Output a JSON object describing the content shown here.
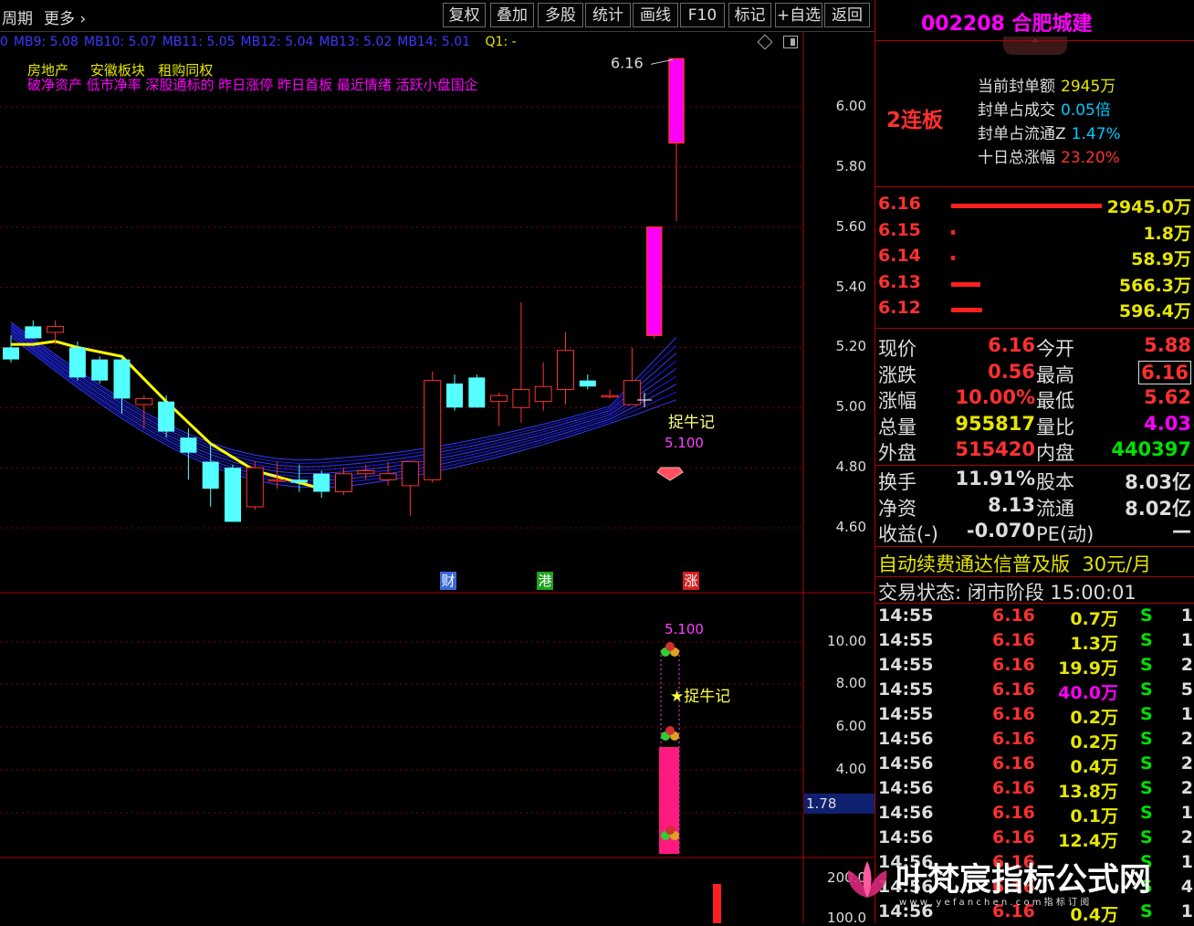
{
  "toolbar": {
    "period": "周期",
    "more": "更多",
    "buttons": [
      "复权",
      "叠加",
      "多股",
      "统计",
      "画线",
      "F10",
      "标记",
      "+自选",
      "返回"
    ]
  },
  "ma_row": {
    "items": [
      "0",
      "MB9: 5.08",
      "MB10: 5.07",
      "MB11: 5.05",
      "MB12: 5.04",
      "MB13: 5.02",
      "MB14: 5.01"
    ],
    "q1": "Q1: -"
  },
  "tags": {
    "line1": [
      "房地产",
      "安徽板块",
      "租购同权"
    ],
    "line2": "破净资产 低市净率 深股通标的 昨日涨停 昨日首板 最近情绪 活跃小盘国企"
  },
  "main_chart": {
    "high_label": "6.16",
    "annotation": "捉牛记",
    "annotation_value": "5.100",
    "y_ticks": [
      "6.00",
      "5.80",
      "5.60",
      "5.40",
      "5.20",
      "5.00",
      "4.80",
      "4.60"
    ],
    "markers": [
      {
        "text": "财",
        "color": "#3a6ad8"
      },
      {
        "text": "港",
        "color": "#20a020"
      },
      {
        "text": "涨",
        "color": "#d02020"
      }
    ]
  },
  "sub_chart": {
    "value_label": "5.100",
    "annotation": "★捉牛记",
    "y_ticks": [
      "10.00",
      "8.00",
      "6.00",
      "4.00"
    ],
    "current": "1.78"
  },
  "vol_chart": {
    "y_ticks": [
      "200.0",
      "100.0"
    ]
  },
  "panel": {
    "code_name": "002208 合肥城建",
    "limit_label": "2连板",
    "limit_info": [
      {
        "label": "当前封单额",
        "value": "2945万",
        "color": "#e6e600"
      },
      {
        "label": "封单占成交",
        "value": "0.05倍",
        "color": "#00c8ff"
      },
      {
        "label": "封单占流通Z",
        "value": "1.47%",
        "color": "#00c8ff"
      },
      {
        "label": "十日总涨幅",
        "value": "23.20%",
        "color": "#ff3030"
      }
    ],
    "order_book": [
      {
        "price": "6.16",
        "volume": "2945.0万",
        "bar": 0.98
      },
      {
        "price": "6.15",
        "volume": "1.8万",
        "bar": 0.02
      },
      {
        "price": "6.14",
        "volume": "58.9万",
        "bar": 0.02
      },
      {
        "price": "6.13",
        "volume": "566.3万",
        "bar": 0.19
      },
      {
        "price": "6.12",
        "volume": "596.4万",
        "bar": 0.2
      }
    ],
    "quotes_a": [
      {
        "l1": "现价",
        "v1": "6.16",
        "c1": "#ff3030",
        "l2": "今开",
        "v2": "5.88",
        "c2": "#ff3030"
      },
      {
        "l1": "涨跌",
        "v1": "0.56",
        "c1": "#ff3030",
        "l2": "最高",
        "v2": "6.16",
        "c2": "#ff3030"
      },
      {
        "l1": "涨幅",
        "v1": "10.00%",
        "c1": "#ff3030",
        "l2": "最低",
        "v2": "5.62",
        "c2": "#ff3030"
      },
      {
        "l1": "总量",
        "v1": "955817",
        "c1": "#e6e600",
        "l2": "量比",
        "v2": "4.03",
        "c2": "#ff00ff"
      },
      {
        "l1": "外盘",
        "v1": "515420",
        "c1": "#ff3030",
        "l2": "内盘",
        "v2": "440397",
        "c2": "#00e000"
      }
    ],
    "quotes_b": [
      {
        "l1": "换手",
        "v1": "11.91%",
        "c1": "#ddd",
        "l2": "股本",
        "v2": "8.03亿",
        "c2": "#ddd"
      },
      {
        "l1": "净资",
        "v1": "8.13",
        "c1": "#ddd",
        "l2": "流通",
        "v2": "8.02亿",
        "c2": "#ddd"
      },
      {
        "l1": "收益(-)",
        "v1": "-0.070",
        "c1": "#ddd",
        "l2": "PE(动)",
        "v2": "—",
        "c2": "#ddd"
      }
    ],
    "promo": "自动续费通达信普及版  30元/月",
    "trade_status": "交易状态: 闭市阶段 15:00:01",
    "ticks": [
      {
        "time": "14:55",
        "price": "6.16",
        "vol": "0.7万",
        "side": "S",
        "n": "1",
        "vc": "#e6e600"
      },
      {
        "time": "14:55",
        "price": "6.16",
        "vol": "1.3万",
        "side": "S",
        "n": "1",
        "vc": "#e6e600"
      },
      {
        "time": "14:55",
        "price": "6.16",
        "vol": "19.9万",
        "side": "S",
        "n": "2",
        "vc": "#e6e600"
      },
      {
        "time": "14:55",
        "price": "6.16",
        "vol": "40.0万",
        "side": "S",
        "n": "5",
        "vc": "#ff00ff"
      },
      {
        "time": "14:55",
        "price": "6.16",
        "vol": "0.2万",
        "side": "S",
        "n": "1",
        "vc": "#e6e600"
      },
      {
        "time": "14:56",
        "price": "6.16",
        "vol": "0.2万",
        "side": "S",
        "n": "2",
        "vc": "#e6e600"
      },
      {
        "time": "14:56",
        "price": "6.16",
        "vol": "0.4万",
        "side": "S",
        "n": "2",
        "vc": "#e6e600"
      },
      {
        "time": "14:56",
        "price": "6.16",
        "vol": "13.8万",
        "side": "S",
        "n": "2",
        "vc": "#e6e600"
      },
      {
        "time": "14:56",
        "price": "6.16",
        "vol": "0.1万",
        "side": "S",
        "n": "1",
        "vc": "#e6e600"
      },
      {
        "time": "14:56",
        "price": "6.16",
        "vol": "12.4万",
        "side": "S",
        "n": "2",
        "vc": "#e6e600"
      },
      {
        "time": "14:56",
        "price": "6.16",
        "vol": "",
        "side": "S",
        "n": "1",
        "vc": "#e6e600"
      },
      {
        "time": "14:56",
        "price": "6.16",
        "vol": "",
        "side": "S",
        "n": "4",
        "vc": "#e6e600"
      },
      {
        "time": "14:56",
        "price": "6.16",
        "vol": "0.4万",
        "side": "S",
        "n": "1",
        "vc": "#e6e600"
      }
    ]
  },
  "watermark": {
    "title": "叶梵宸指标公式网",
    "sub": "w w w . y e f a n c h e n . c o m  指 标 订 阅"
  },
  "candles": [
    {
      "o": 5.2,
      "h": 5.24,
      "l": 5.15,
      "c": 5.16
    },
    {
      "o": 5.27,
      "h": 5.29,
      "l": 5.23,
      "c": 5.23
    },
    {
      "o": 5.25,
      "h": 5.29,
      "l": 5.21,
      "c": 5.27
    },
    {
      "o": 5.2,
      "h": 5.22,
      "l": 5.09,
      "c": 5.1
    },
    {
      "o": 5.16,
      "h": 5.17,
      "l": 5.08,
      "c": 5.09
    },
    {
      "o": 5.16,
      "h": 5.17,
      "l": 4.98,
      "c": 5.03
    },
    {
      "o": 5.01,
      "h": 5.04,
      "l": 4.93,
      "c": 5.03
    },
    {
      "o": 5.02,
      "h": 5.04,
      "l": 4.9,
      "c": 4.92
    },
    {
      "o": 4.9,
      "h": 4.93,
      "l": 4.76,
      "c": 4.85
    },
    {
      "o": 4.82,
      "h": 4.88,
      "l": 4.67,
      "c": 4.73
    },
    {
      "o": 4.8,
      "h": 4.81,
      "l": 4.62,
      "c": 4.62
    },
    {
      "o": 4.67,
      "h": 4.82,
      "l": 4.66,
      "c": 4.8
    },
    {
      "o": 4.76,
      "h": 4.82,
      "l": 4.73,
      "c": 4.76
    },
    {
      "o": 4.76,
      "h": 4.81,
      "l": 4.72,
      "c": 4.75
    },
    {
      "o": 4.78,
      "h": 4.79,
      "l": 4.7,
      "c": 4.72
    },
    {
      "o": 4.72,
      "h": 4.8,
      "l": 4.71,
      "c": 4.78
    },
    {
      "o": 4.78,
      "h": 4.81,
      "l": 4.76,
      "c": 4.79
    },
    {
      "o": 4.76,
      "h": 4.82,
      "l": 4.74,
      "c": 4.78
    },
    {
      "o": 4.74,
      "h": 4.82,
      "l": 4.64,
      "c": 4.82
    },
    {
      "o": 4.76,
      "h": 5.12,
      "l": 4.75,
      "c": 5.09
    },
    {
      "o": 5.08,
      "h": 5.11,
      "l": 4.99,
      "c": 5.0
    },
    {
      "o": 5.1,
      "h": 5.11,
      "l": 5.0,
      "c": 5.0
    },
    {
      "o": 5.02,
      "h": 5.05,
      "l": 4.94,
      "c": 5.04
    },
    {
      "o": 5.0,
      "h": 5.35,
      "l": 4.95,
      "c": 5.06
    },
    {
      "o": 5.02,
      "h": 5.15,
      "l": 4.99,
      "c": 5.07
    },
    {
      "o": 5.06,
      "h": 5.25,
      "l": 5.01,
      "c": 5.19
    },
    {
      "o": 5.09,
      "h": 5.11,
      "l": 5.06,
      "c": 5.07
    },
    {
      "o": 5.04,
      "h": 5.06,
      "l": 5.03,
      "c": 5.04
    },
    {
      "o": 5.01,
      "h": 5.2,
      "l": 5.01,
      "c": 5.09
    },
    {
      "o": 5.24,
      "h": 5.6,
      "l": 5.23,
      "c": 5.6
    },
    {
      "o": 5.88,
      "h": 6.16,
      "l": 5.62,
      "c": 6.16
    }
  ]
}
